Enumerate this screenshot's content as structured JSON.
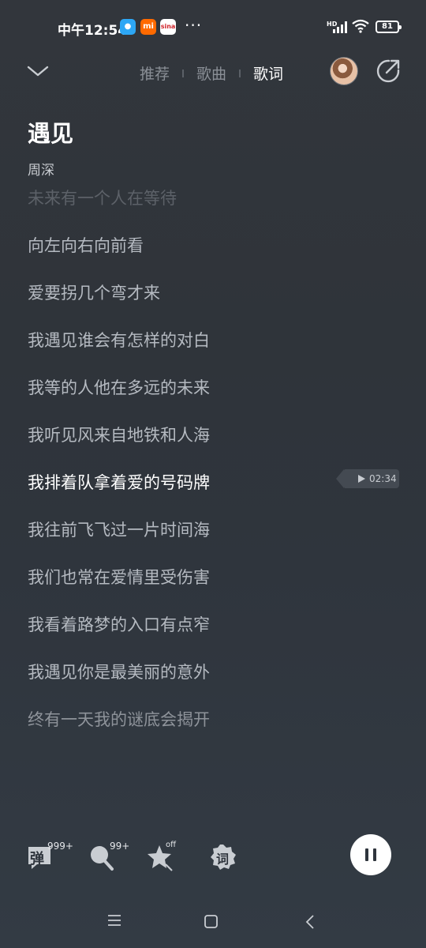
{
  "status": {
    "time": "中午12:54",
    "apps": [
      "app-blue-icon",
      "mi-icon",
      "sina-icon"
    ],
    "mi_label": "mi",
    "sina_label": "sina",
    "more": "···",
    "hd": "HD",
    "battery": "81"
  },
  "tabs": [
    {
      "label": "推荐",
      "active": false
    },
    {
      "label": "歌曲",
      "active": false
    },
    {
      "label": "歌词",
      "active": true
    }
  ],
  "song": {
    "title": "遇见",
    "singer": "周深"
  },
  "lyrics": [
    {
      "text": "未来有一个人在等待",
      "state": "faded"
    },
    {
      "text": "向左向右向前看",
      "state": "normal"
    },
    {
      "text": "爱要拐几个弯才来",
      "state": "normal"
    },
    {
      "text": "我遇见谁会有怎样的对白",
      "state": "normal"
    },
    {
      "text": "我等的人他在多远的未来",
      "state": "normal"
    },
    {
      "text": "我听见风来自地铁和人海",
      "state": "normal"
    },
    {
      "text": "我排着队拿着爱的号码牌",
      "state": "current"
    },
    {
      "text": "我往前飞飞过一片时间海",
      "state": "normal"
    },
    {
      "text": "我们也常在爱情里受伤害",
      "state": "normal"
    },
    {
      "text": "我看着路梦的入口有点窄",
      "state": "normal"
    },
    {
      "text": "我遇见你是最美丽的意外",
      "state": "normal"
    },
    {
      "text": "终有一天我的谜底会揭开",
      "state": "dim"
    }
  ],
  "seek_time": "02:34",
  "bottom": {
    "danmu_label": "弹",
    "danmu_count": "999+",
    "comment_count": "99+",
    "star_status": "off",
    "lyric_label": "词"
  }
}
